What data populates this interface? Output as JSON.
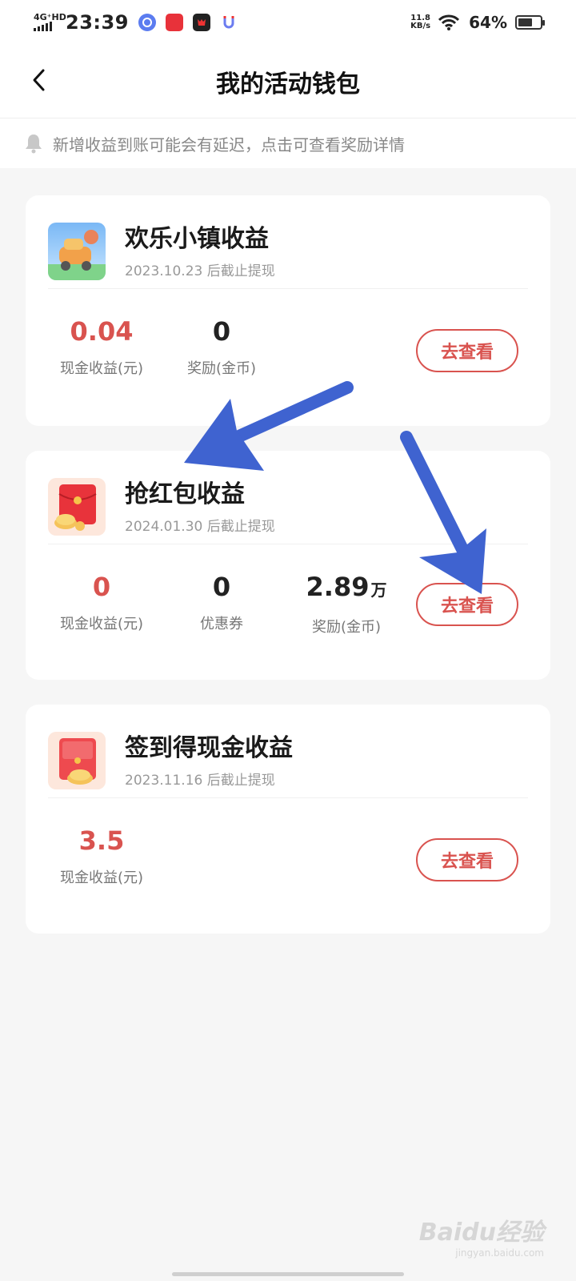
{
  "status_bar": {
    "network": "4G⁺HD",
    "time": "23:39",
    "speed_value": "11.8",
    "speed_unit": "KB/s",
    "battery_text": "64%",
    "battery_level": 0.64
  },
  "header": {
    "title": "我的活动钱包"
  },
  "notice": {
    "text": "新增收益到账可能会有延迟，点击可查看奖励详情"
  },
  "cards": [
    {
      "title": "欢乐小镇收益",
      "subtitle": "2023.10.23 后截止提现",
      "stats": [
        {
          "value": "0.04",
          "label": "现金收益(元)"
        },
        {
          "value": "0",
          "label": "奖励(金币)"
        }
      ],
      "button": "去查看"
    },
    {
      "title": "抢红包收益",
      "subtitle": "2024.01.30 后截止提现",
      "stats": [
        {
          "value": "0",
          "label": "现金收益(元)"
        },
        {
          "value": "0",
          "label": "优惠券"
        },
        {
          "value": "2.89",
          "unit": "万",
          "label": "奖励(金币)"
        }
      ],
      "button": "去查看"
    },
    {
      "title": "签到得现金收益",
      "subtitle": "2023.11.16 后截止提现",
      "stats": [
        {
          "value": "3.5",
          "label": "现金收益(元)"
        }
      ],
      "button": "去查看"
    }
  ],
  "watermark": {
    "main": "Baidu经验",
    "sub": "jingyan.baidu.com"
  },
  "colors": {
    "accent": "#d9534f",
    "arrow": "#3f63d0",
    "background": "#f6f6f6"
  }
}
